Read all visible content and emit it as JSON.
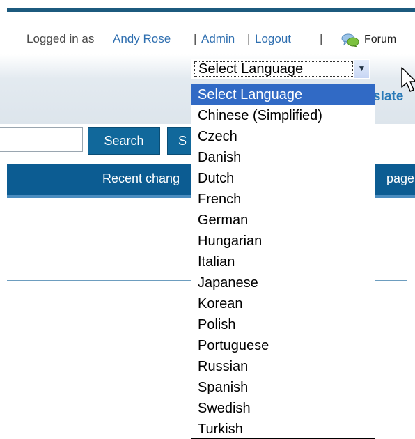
{
  "user_bar": {
    "logged_in_text": "Logged in as",
    "user_name": "Andy Rose",
    "sep1": "|",
    "admin": "Admin",
    "sep2": "|",
    "logout": "Logout",
    "sep3": "|",
    "forum": "Forum"
  },
  "toolbar": {
    "translate_partial": "slate",
    "search_label": "Search",
    "second_button_partial": "S",
    "search_value": ""
  },
  "nav": {
    "left_partial": "Recent chang",
    "right_partial": "page"
  },
  "language_select": {
    "selected": "Select Language",
    "options": [
      "Select Language",
      "Chinese (Simplified)",
      "Czech",
      "Danish",
      "Dutch",
      "French",
      "German",
      "Hungarian",
      "Italian",
      "Japanese",
      "Korean",
      "Polish",
      "Portuguese",
      "Russian",
      "Spanish",
      "Swedish",
      "Turkish"
    ],
    "highlighted_index": 0
  },
  "colors": {
    "header_bar": "#1c5a7e",
    "link": "#2f6fb0",
    "button": "#11689b",
    "nav_bar": "#0c5c92",
    "highlight": "#316ac5"
  }
}
